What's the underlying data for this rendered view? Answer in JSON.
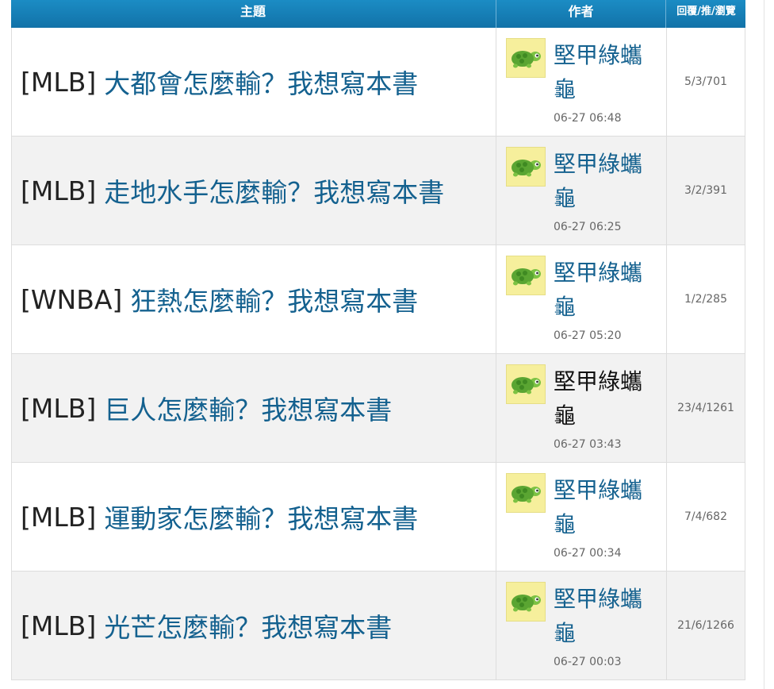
{
  "header": {
    "subject": "主題",
    "author": "作者",
    "stats": "回覆/推/瀏覽"
  },
  "rows": [
    {
      "tag": "[MLB]",
      "title": "大都會怎麼輸？我想寫本書",
      "author_line1": "堅甲綠蠵",
      "author_line2": "龜",
      "author_linked": true,
      "time": "06-27 06:48",
      "stats": "5/3/701"
    },
    {
      "tag": "[MLB]",
      "title": "走地水手怎麼輸？我想寫本書",
      "author_line1": "堅甲綠蠵",
      "author_line2": "龜",
      "author_linked": true,
      "time": "06-27 06:25",
      "stats": "3/2/391"
    },
    {
      "tag": "[WNBA]",
      "title": "狂熱怎麼輸？我想寫本書",
      "author_line1": "堅甲綠蠵",
      "author_line2": "龜",
      "author_linked": true,
      "time": "06-27 05:20",
      "stats": "1/2/285"
    },
    {
      "tag": "[MLB]",
      "title": "巨人怎麼輸？我想寫本書",
      "author_line1": "堅甲綠蠵",
      "author_line2": "龜",
      "author_linked": false,
      "time": "06-27 03:43",
      "stats": "23/4/1261"
    },
    {
      "tag": "[MLB]",
      "title": "運動家怎麼輸？我想寫本書",
      "author_line1": "堅甲綠蠵",
      "author_line2": "龜",
      "author_linked": true,
      "time": "06-27 00:34",
      "stats": "7/4/682"
    },
    {
      "tag": "[MLB]",
      "title": "光芒怎麼輸？我想寫本書",
      "author_line1": "堅甲綠蠵",
      "author_line2": "龜",
      "author_linked": true,
      "time": "06-27 00:03",
      "stats": "21/6/1266"
    }
  ],
  "avatar_icon": "turtle-icon",
  "colors": {
    "header_bg": "#1578b0",
    "link": "#14618f",
    "row_alt": "#f2f2f2",
    "avatar_bg": "#f6ef9c"
  }
}
